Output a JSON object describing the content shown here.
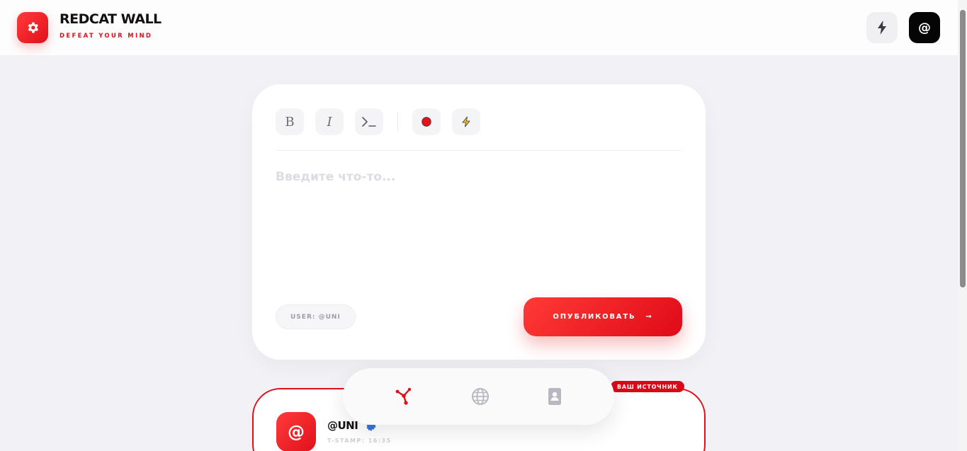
{
  "header": {
    "title": "REDCAT WALL",
    "subtitle": "DEFEAT YOUR MIND",
    "logo_icon": "gear-icon",
    "right_buttons": [
      {
        "icon": "lightning-icon"
      },
      {
        "label": "@"
      }
    ]
  },
  "editor": {
    "toolbar": [
      {
        "label": "B",
        "icon": "bold-icon"
      },
      {
        "label": "I",
        "icon": "italic-icon"
      },
      {
        "icon": "terminal-icon"
      },
      {
        "icon": "record-icon"
      },
      {
        "icon": "lightning-icon"
      }
    ],
    "placeholder": "Введите что-то...",
    "user_label": "USER: @UNI",
    "publish_label": "ОПУБЛИКОВАТЬ",
    "publish_arrow": "→"
  },
  "post": {
    "tag": "ВАШ ИСТОЧНИК",
    "avatar": "@",
    "username": "@UNI",
    "timestamp": "T-STAMP: 16:35"
  },
  "nav": {
    "items": [
      {
        "icon": "network-icon",
        "active": true
      },
      {
        "icon": "globe-icon",
        "active": false
      },
      {
        "icon": "contact-card-icon",
        "active": false
      }
    ]
  },
  "colors": {
    "accent": "#e0101a",
    "background": "#f2f1f6",
    "verified": "#3a73e0"
  }
}
